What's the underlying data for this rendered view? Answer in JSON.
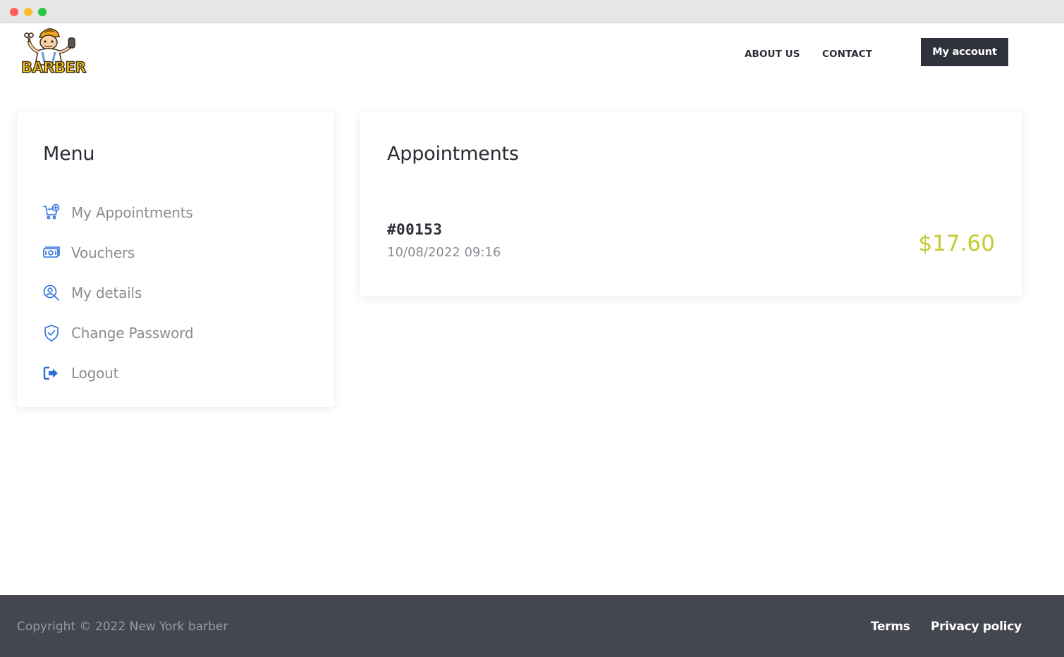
{
  "brand": {
    "logo_text": "BARBER",
    "accent_color": "#c2cc2d",
    "dark_color": "#2f323c",
    "icon_color": "#2f6fdb"
  },
  "nav": {
    "about": "ABOUT US",
    "contact": "CONTACT",
    "account_button": "My account"
  },
  "menu": {
    "title": "Menu",
    "items": [
      {
        "label": "My Appointments",
        "icon": "cart-plus-icon"
      },
      {
        "label": "Vouchers",
        "icon": "banknote-icon"
      },
      {
        "label": "My details",
        "icon": "user-search-icon"
      },
      {
        "label": "Change Password",
        "icon": "shield-check-icon"
      },
      {
        "label": "Logout",
        "icon": "logout-icon"
      }
    ]
  },
  "appointments": {
    "title": "Appointments",
    "items": [
      {
        "id": "#00153",
        "date": "10/08/2022 09:16",
        "price": "$17.60"
      }
    ]
  },
  "footer": {
    "copyright": "Copyright © 2022 New York barber",
    "terms": "Terms",
    "privacy": "Privacy policy"
  }
}
